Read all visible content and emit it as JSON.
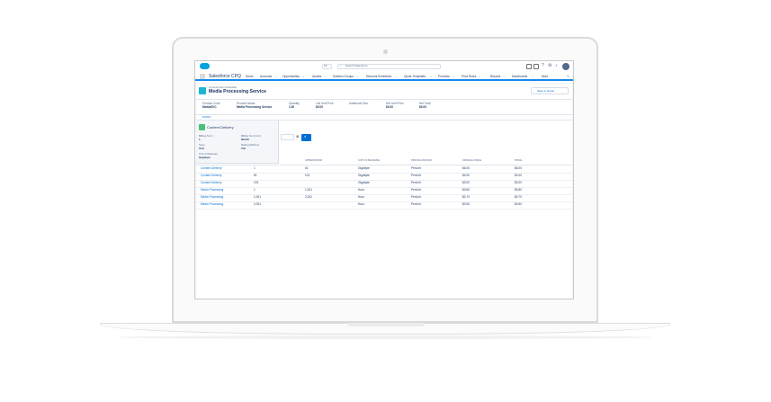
{
  "app": {
    "name": "Salesforce CPQ",
    "search_scope": "All",
    "search_placeholder": "Search Salesforce",
    "nav": [
      {
        "label": "Home"
      },
      {
        "label": "Accounts"
      },
      {
        "label": "Opportunities"
      },
      {
        "label": "Quotes"
      },
      {
        "label": "Solution Groups"
      },
      {
        "label": "Discount Schedules"
      },
      {
        "label": "Quote Templates"
      },
      {
        "label": "Products"
      },
      {
        "label": "Price Rules"
      },
      {
        "label": "Reports"
      },
      {
        "label": "Dashboards"
      },
      {
        "label": "More"
      }
    ]
  },
  "header": {
    "object_label": "Consumption Schedule",
    "title": "Media Processing Service",
    "save_label": "Save to Quote"
  },
  "summary": {
    "fields": [
      {
        "label": "Product Code",
        "value": "MediaSVC"
      },
      {
        "label": "Product Name",
        "value": "Media Processing Service"
      },
      {
        "label": "Quantity",
        "value": "1.00"
      },
      {
        "label": "List Unit Price",
        "value": "$0.00"
      },
      {
        "label": "Additional Disc.",
        "value": ""
      },
      {
        "label": "Net Unit Price",
        "value": "$0.00"
      },
      {
        "label": "Net Total",
        "value": "$0.00"
      }
    ]
  },
  "tab_label": "RATES",
  "popover": {
    "title": "Content Delivery",
    "fields": [
      {
        "label": "Billing Term",
        "value": "1"
      },
      {
        "label": "Billing Term Unit",
        "value": "Month"
      },
      {
        "label": "Type",
        "value": "Unit"
      },
      {
        "label": "Rating Method",
        "value": "Tier"
      },
      {
        "label": "Unit of Measure",
        "value": "Gigabyte"
      }
    ]
  },
  "table": {
    "headers": [
      "UPPER BOUND",
      "UNIT OF MEASURE",
      "PRICING METHOD",
      "ORIGINAL PRICE",
      "PRICE"
    ],
    "rows": [
      {
        "name": "Content Delivery",
        "lower": "1",
        "upper": "51",
        "unit": "Gigabyte",
        "method": "PerUnit",
        "original": "$6.00",
        "price": "$6.00"
      },
      {
        "name": "Content Delivery",
        "lower": "51",
        "upper": "101",
        "unit": "Gigabyte",
        "method": "PerUnit",
        "original": "$4.00",
        "price": "$4.00"
      },
      {
        "name": "Content Delivery",
        "lower": "101",
        "upper": "",
        "unit": "Gigabyte",
        "method": "PerUnit",
        "original": "$3.00",
        "price": "$3.00"
      },
      {
        "name": "Media Processing",
        "lower": "1",
        "upper": "1,001",
        "unit": "Hour",
        "method": "PerUnit",
        "original": "$0.80",
        "price": "$0.80"
      },
      {
        "name": "Media Processing",
        "lower": "1,001",
        "upper": "2,001",
        "unit": "Hour",
        "method": "PerUnit",
        "original": "$0.70",
        "price": "$0.70"
      },
      {
        "name": "Media Processing",
        "lower": "2,001",
        "upper": "",
        "unit": "Hour",
        "method": "PerUnit",
        "original": "$0.50",
        "price": "$0.50"
      }
    ]
  },
  "colors": {
    "brand": "#00a1e0",
    "link": "#0070d2",
    "nav_underline": "#1589ee"
  }
}
